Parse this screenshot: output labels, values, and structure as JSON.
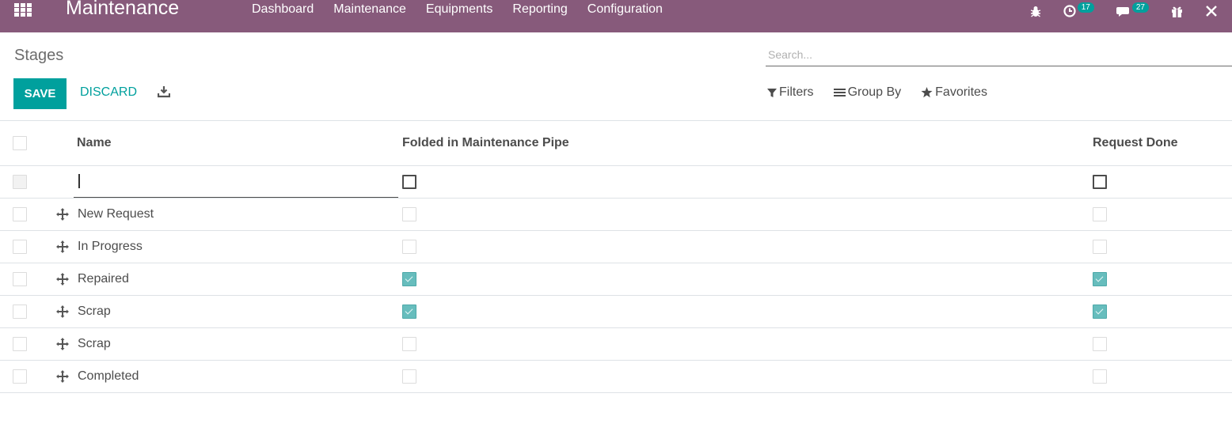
{
  "navbar": {
    "app_title": "Maintenance",
    "menu": [
      "Dashboard",
      "Maintenance",
      "Equipments",
      "Reporting",
      "Configuration"
    ],
    "activity_count": "17",
    "messages_count": "27",
    "background": "#875a7b"
  },
  "control_panel": {
    "breadcrumb": "Stages",
    "search_placeholder": "Search...",
    "save_label": "SAVE",
    "discard_label": "DISCARD",
    "filters_label": "Filters",
    "group_by_label": "Group By",
    "favorites_label": "Favorites",
    "accent": "#00a09d"
  },
  "table": {
    "columns": {
      "name": "Name",
      "folded": "Folded in Maintenance Pipe",
      "done": "Request Done"
    },
    "rows": [
      {
        "name": "New Request",
        "folded": false,
        "done": false
      },
      {
        "name": "In Progress",
        "folded": false,
        "done": false
      },
      {
        "name": "Repaired",
        "folded": true,
        "done": true
      },
      {
        "name": "Scrap",
        "folded": true,
        "done": true
      },
      {
        "name": "Scrap",
        "folded": false,
        "done": false
      },
      {
        "name": "Completed",
        "folded": false,
        "done": false
      }
    ]
  }
}
